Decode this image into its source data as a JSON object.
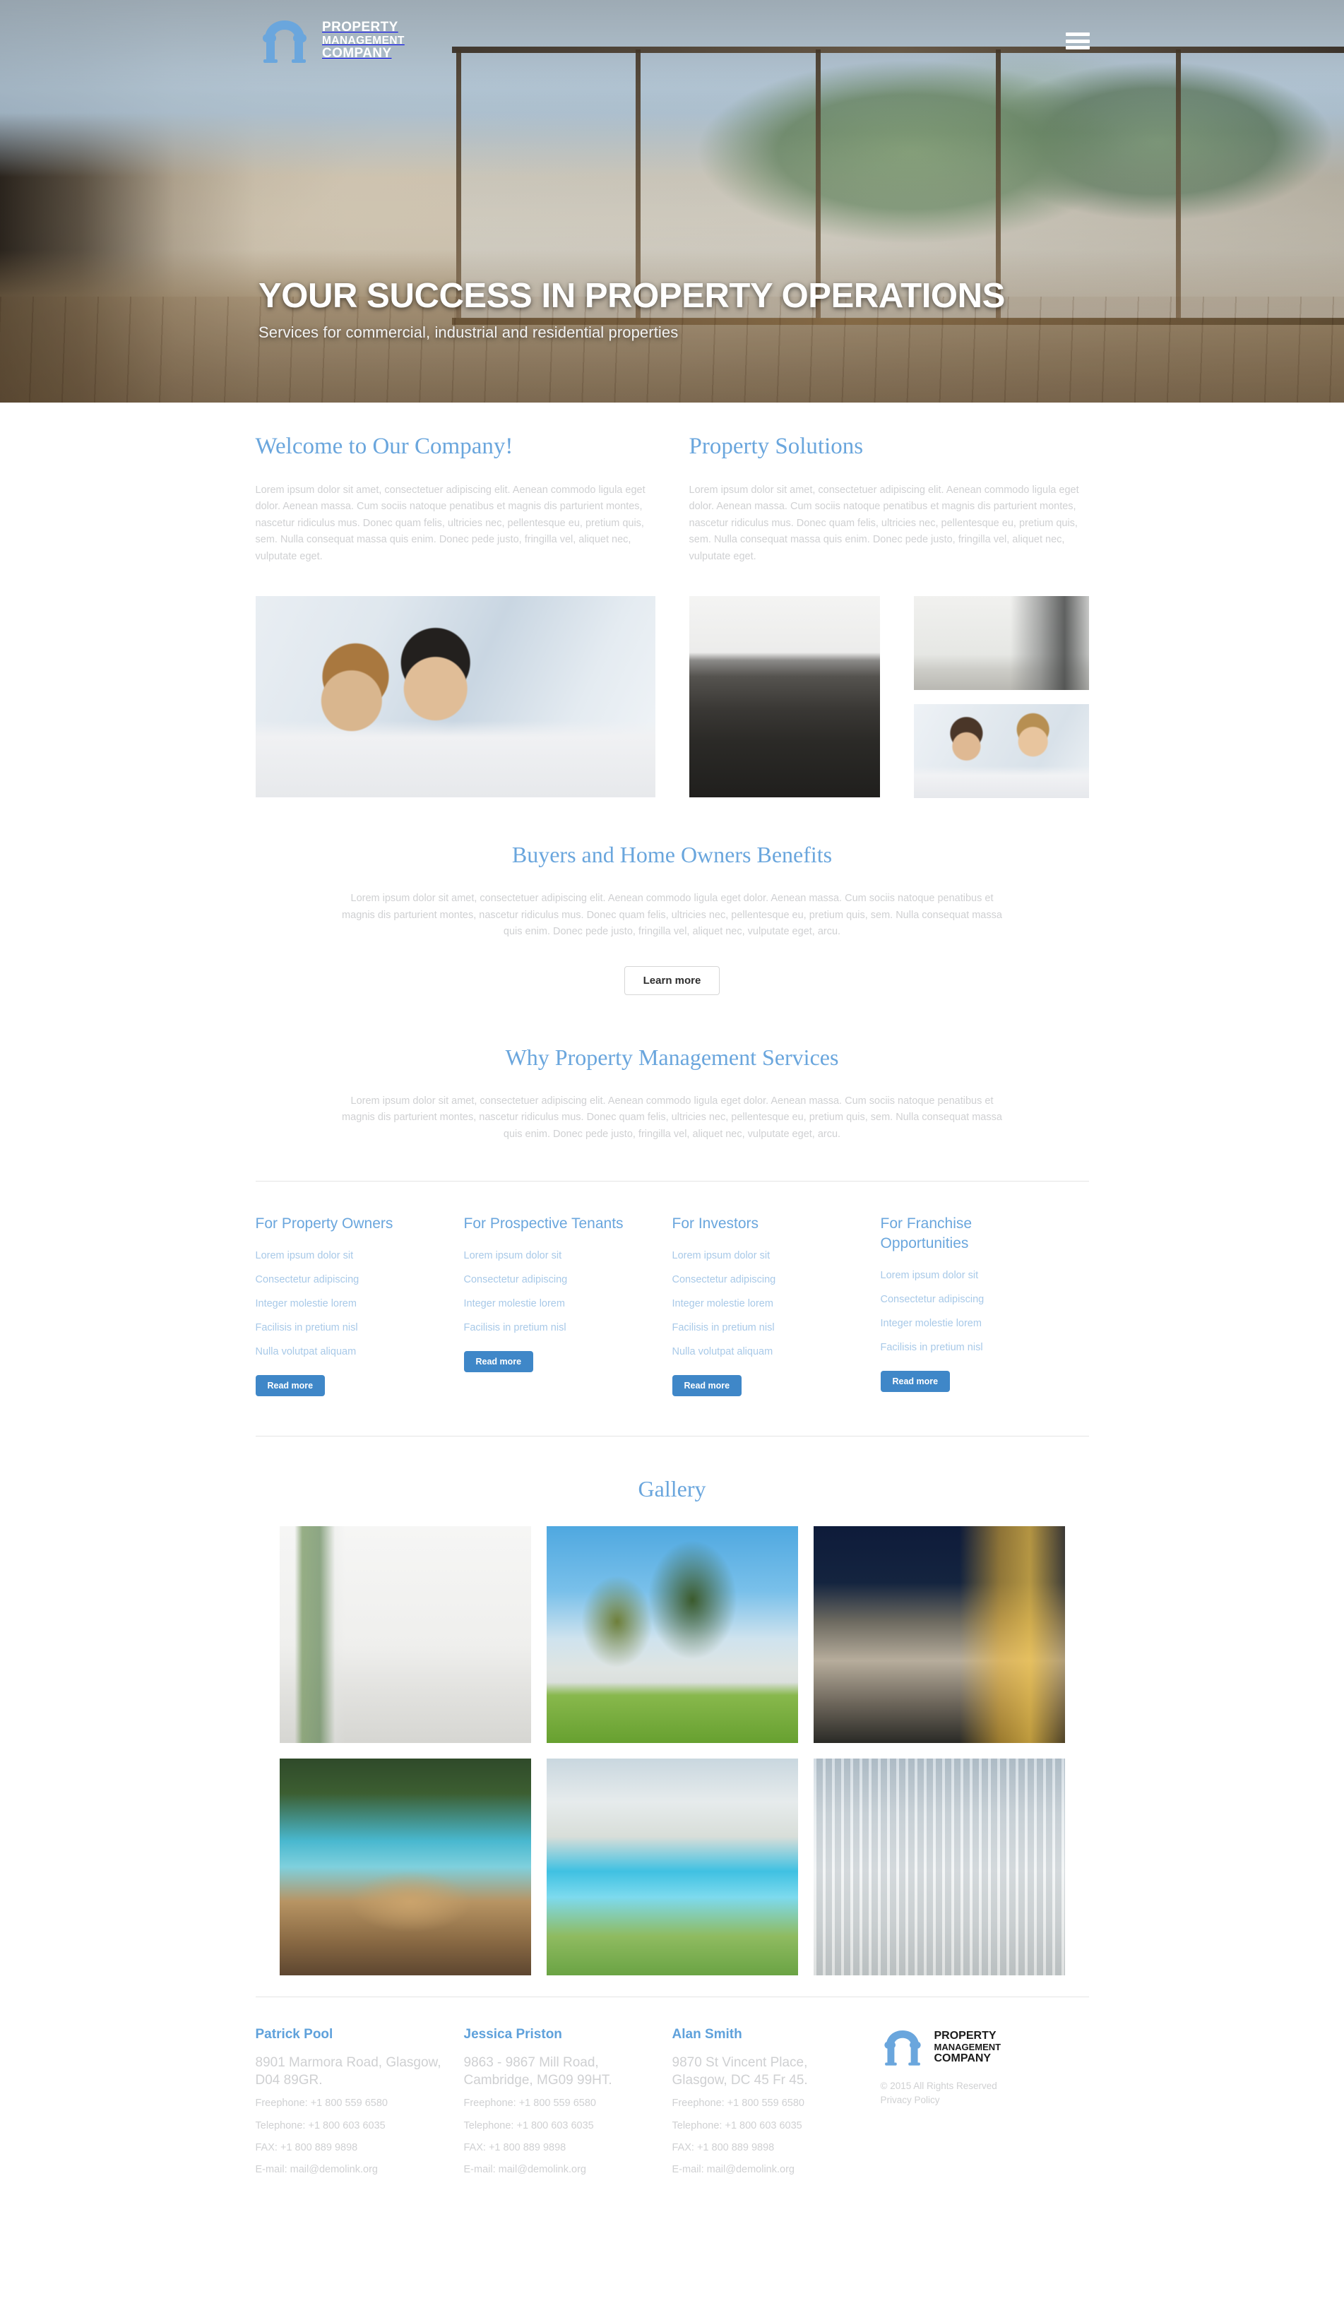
{
  "brand": {
    "line1": "PROPERTY",
    "line2": "MANAGEMENT",
    "line3": "COMPANY",
    "logo_icon": "arch-logo-icon",
    "accent_color": "#6aa6dd",
    "button_blue": "#3f87c8"
  },
  "header": {
    "menu_icon": "hamburger-menu-icon"
  },
  "hero": {
    "title": "YOUR SUCCESS IN PROPERTY OPERATIONS",
    "subtitle": "Services for commercial, industrial and residential properties"
  },
  "intro": {
    "left": {
      "heading": "Welcome to Our Company!",
      "text": "Lorem ipsum dolor sit amet, consectetuer adipiscing elit. Aenean commodo ligula eget dolor. Aenean massa. Cum sociis natoque penatibus et magnis dis parturient montes, nascetur ridiculus mus. Donec quam felis, ultricies nec, pellentesque eu, pretium quis, sem. Nulla consequat massa quis enim. Donec pede justo, fringilla vel, aliquet nec, vulputate eget."
    },
    "right": {
      "heading": "Property Solutions",
      "text": "Lorem ipsum dolor sit amet, consectetuer adipiscing elit. Aenean commodo ligula eget dolor. Aenean massa. Cum sociis natoque penatibus et magnis dis parturient montes, nascetur ridiculus mus. Donec quam felis, ultricies nec, pellentesque eu, pretium quis, sem. Nulla consequat massa quis enim. Donec pede justo, fringilla vel, aliquet nec, vulputate eget."
    },
    "images": {
      "meeting": "business-meeting-photo",
      "lounge": "modern-lounge-interior-photo",
      "kitchen": "white-kitchen-interior-photo",
      "consult": "couple-consultation-photo"
    }
  },
  "benefits": {
    "heading": "Buyers and Home Owners Benefits",
    "text": "Lorem ipsum dolor sit amet, consectetuer adipiscing elit. Aenean commodo ligula eget dolor. Aenean massa. Cum sociis natoque penatibus et magnis dis parturient montes, nascetur ridiculus mus. Donec quam felis, ultricies nec, pellentesque eu, pretium quis, sem. Nulla consequat massa quis enim. Donec pede justo, fringilla vel, aliquet nec, vulputate eget, arcu.",
    "button": "Learn more"
  },
  "why": {
    "heading": "Why Property Management Services",
    "text": "Lorem ipsum dolor sit amet, consectetuer adipiscing elit. Aenean commodo ligula eget dolor. Aenean massa. Cum sociis natoque penatibus et magnis dis parturient montes, nascetur ridiculus mus. Donec quam felis, ultricies nec, pellentesque eu, pretium quis, sem. Nulla consequat massa quis enim. Donec pede justo, fringilla vel, aliquet nec, vulputate eget, arcu."
  },
  "services": {
    "read_more": "Read more",
    "columns": [
      {
        "title": "For Property Owners",
        "links": [
          "Lorem ipsum dolor sit",
          "Consectetur adipiscing",
          "Integer molestie lorem",
          "Facilisis in pretium nisl",
          "Nulla volutpat aliquam"
        ]
      },
      {
        "title": "For Prospective Tenants",
        "links": [
          "Lorem ipsum dolor sit",
          "Consectetur adipiscing",
          "Integer molestie lorem",
          "Facilisis in pretium nisl"
        ]
      },
      {
        "title": "For Investors",
        "links": [
          "Lorem ipsum dolor sit",
          "Consectetur adipiscing",
          "Integer molestie lorem",
          "Facilisis in pretium nisl",
          "Nulla volutpat aliquam"
        ]
      },
      {
        "title": "For Franchise Opportunities",
        "links": [
          "Lorem ipsum dolor sit",
          "Consectetur adipiscing",
          "Integer molestie lorem",
          "Facilisis in pretium nisl"
        ]
      }
    ]
  },
  "gallery": {
    "heading": "Gallery",
    "items": [
      "empty-white-room-photo",
      "house-with-lawn-photo",
      "modern-house-at-night-photo",
      "poolside-terrace-table-photo",
      "villa-with-swimming-pool-photo",
      "glass-corridor-photo"
    ]
  },
  "footer": {
    "contacts": [
      {
        "name": "Patrick Pool",
        "address": "8901 Marmora Road, Glasgow, D04 89GR.",
        "freephone": "Freephone: +1 800 559 6580",
        "telephone": "Telephone: +1 800 603 6035",
        "fax": "FAX: +1 800 889 9898",
        "email": "E-mail: mail@demolink.org"
      },
      {
        "name": "Jessica Priston",
        "address": "9863 - 9867 Mill Road, Cambridge, MG09 99HT.",
        "freephone": "Freephone: +1 800 559 6580",
        "telephone": "Telephone: +1 800 603 6035",
        "fax": "FAX: +1 800 889 9898",
        "email": "E-mail: mail@demolink.org"
      },
      {
        "name": "Alan Smith",
        "address": "9870 St Vincent Place, Glasgow, DC 45 Fr 45.",
        "freephone": "Freephone: +1 800 559 6580",
        "telephone": "Telephone: +1 800 603 6035",
        "fax": "FAX: +1 800 889 9898",
        "email": "E-mail: mail@demolink.org"
      }
    ],
    "copyright": "© 2015 All Rights Reserved",
    "privacy": "Privacy Policy"
  }
}
